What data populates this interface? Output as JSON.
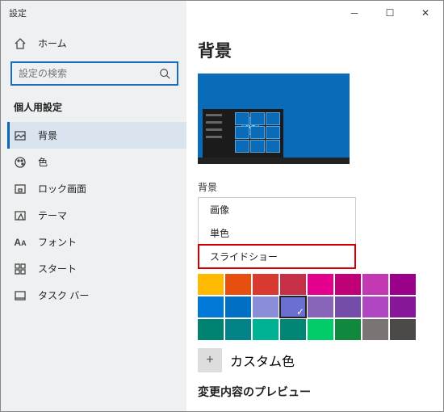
{
  "window": {
    "title": "設定"
  },
  "sidebar": {
    "home": "ホーム",
    "search_placeholder": "設定の検索",
    "section": "個人用設定",
    "items": [
      {
        "label": "背景"
      },
      {
        "label": "色"
      },
      {
        "label": "ロック画面"
      },
      {
        "label": "テーマ"
      },
      {
        "label": "フォント"
      },
      {
        "label": "スタート"
      },
      {
        "label": "タスク バー"
      }
    ]
  },
  "content": {
    "heading": "背景",
    "preview_sample": "Aa",
    "bg_label": "背景",
    "options": [
      "画像",
      "単色",
      "スライドショー"
    ],
    "palette": [
      [
        "#ffb900",
        "#e74f0e",
        "#d83a2f",
        "#c72f46",
        "#e3008c",
        "#bf0077",
        "#c239b3",
        "#9a0089"
      ],
      [
        "#0078d7",
        "#006fc4",
        "#8a8dd8",
        "#6a6fd0",
        "#8764b8",
        "#744da9",
        "#b146c2",
        "#871798"
      ],
      [
        "#008272",
        "#038387",
        "#00b294",
        "#018574",
        "#00cc6a",
        "#10893e",
        "#7a7574",
        "#4c4a48"
      ]
    ],
    "selected": {
      "row": 1,
      "col": 3
    },
    "custom_label": "カスタム色",
    "preview_section": "変更内容のプレビュー"
  }
}
